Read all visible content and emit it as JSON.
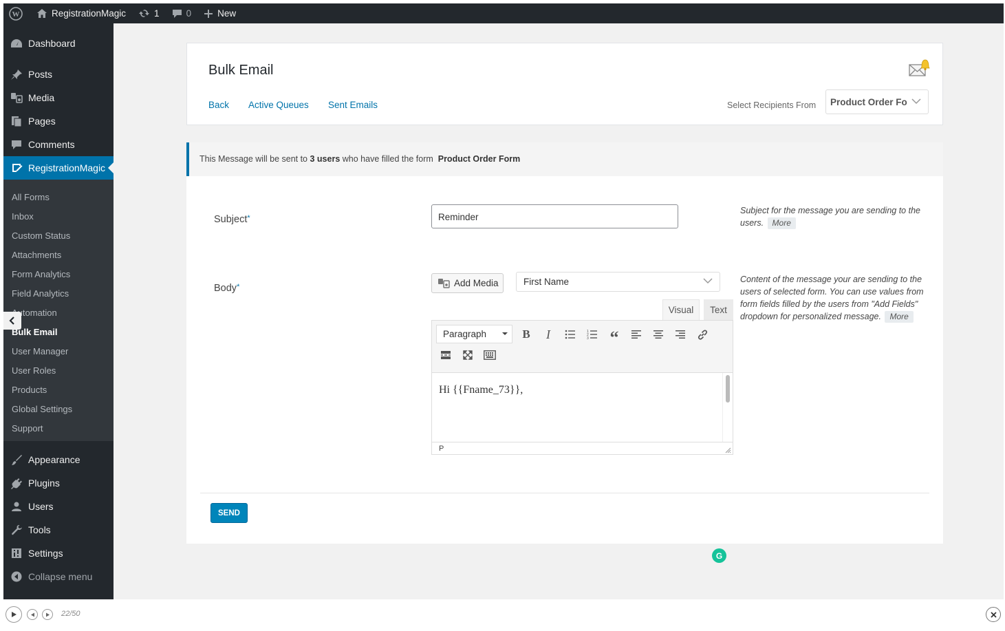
{
  "admin_bar": {
    "site_name": "RegistrationMagic",
    "updates_count": "1",
    "comments_count": "0",
    "new_label": "New"
  },
  "sidebar": {
    "menu": [
      {
        "label": "Dashboard",
        "icon": "dashboard-icon"
      },
      {
        "label": "Posts",
        "icon": "pin-icon"
      },
      {
        "label": "Media",
        "icon": "media-icon"
      },
      {
        "label": "Pages",
        "icon": "pages-icon"
      },
      {
        "label": "Comments",
        "icon": "comment-icon"
      },
      {
        "label": "RegistrationMagic",
        "icon": "form-icon",
        "active": true
      }
    ],
    "submenu": [
      "All Forms",
      "Inbox",
      "Custom Status",
      "Attachments",
      "Form Analytics",
      "Field Analytics",
      "Automation",
      "Bulk Email",
      "User Manager",
      "User Roles",
      "Products",
      "Global Settings",
      "Support"
    ],
    "current_submenu": "Bulk Email",
    "menu_bottom": [
      {
        "label": "Appearance",
        "icon": "brush-icon"
      },
      {
        "label": "Plugins",
        "icon": "plug-icon"
      },
      {
        "label": "Users",
        "icon": "user-icon"
      },
      {
        "label": "Tools",
        "icon": "wrench-icon"
      },
      {
        "label": "Settings",
        "icon": "settings-icon"
      }
    ],
    "collapse_label": "Collapse menu"
  },
  "header": {
    "title": "Bulk Email",
    "links": [
      "Back",
      "Active Queues",
      "Sent Emails"
    ],
    "recipients_label": "Select Recipients From",
    "recipients_value": "Product Order Fo"
  },
  "notice": {
    "prefix": "This Message will be sent to",
    "count": "3 users",
    "middle": "who have filled the form",
    "form_name": "Product Order Form"
  },
  "form": {
    "subject_label": "Subject",
    "subject_value": "Reminder",
    "subject_help": "Subject for the message you are sending to the users.",
    "more_label": "More",
    "body_label": "Body",
    "add_media_label": "Add Media",
    "field_select_value": "First Name",
    "tab_visual": "Visual",
    "tab_text": "Text",
    "paragraph_label": "Paragraph",
    "body_text": "Hi {{Fname_73}},",
    "status_path": "P",
    "body_help": "Content of the message your are sending to the users of selected form. You can use values from form fields filled by the users from \"Add Fields\" dropdown for personalized message.",
    "send_label": "SEND"
  },
  "player": {
    "counter": "22/50"
  },
  "colors": {
    "accent": "#0073aa",
    "sidebar_bg": "#23282d",
    "submenu_bg": "#32373c",
    "send_button": "#0085ba"
  }
}
